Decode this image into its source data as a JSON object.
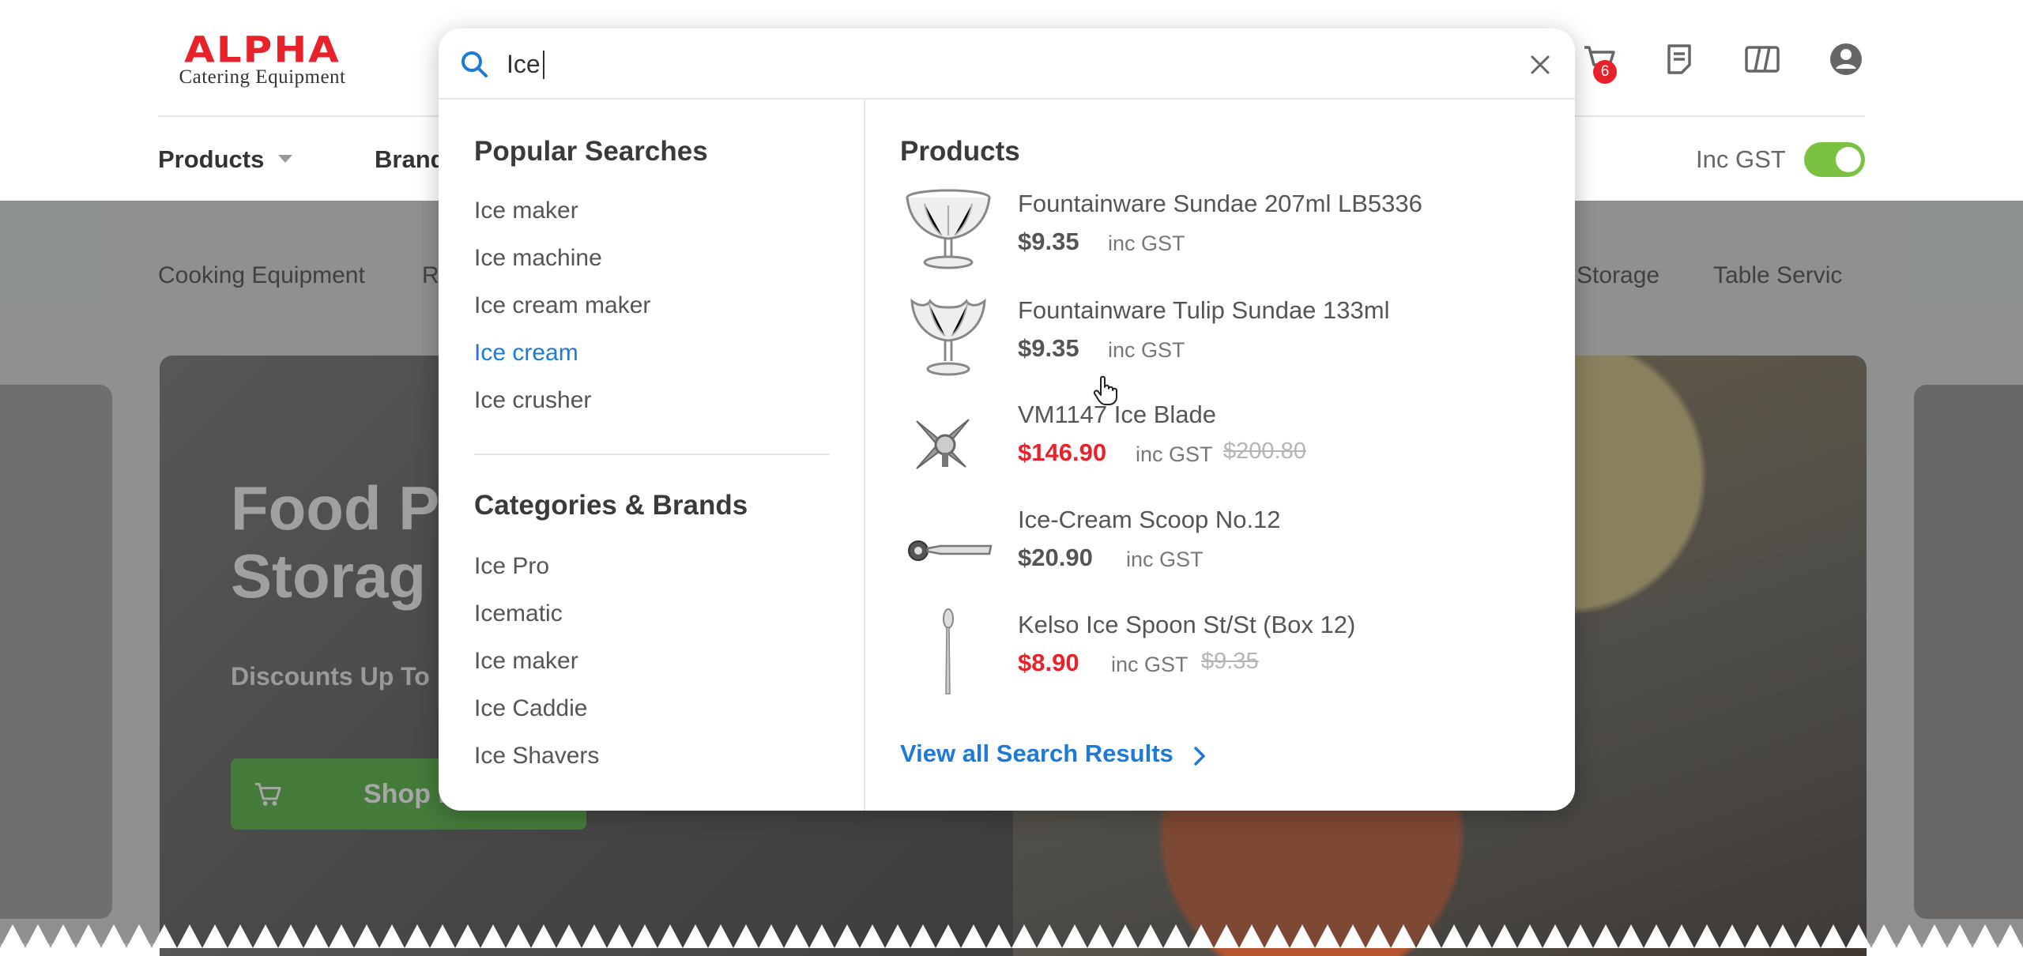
{
  "header": {
    "logo": {
      "word": "ALPHA",
      "sub": "Catering Equipment"
    },
    "icons": [
      "cart-icon",
      "quote-icon",
      "compare-icon",
      "account-icon"
    ],
    "cart_count": "6",
    "nav": {
      "products": "Products",
      "brands": "Brands"
    },
    "gst_label": "Inc GST",
    "gst_toggle_on": true
  },
  "category_bar": [
    "Cooking Equipment",
    "R",
    "Storage",
    "Table Servic"
  ],
  "hero": {
    "title_line1": "Food P",
    "title_line2": "Storag",
    "subtitle": "Discounts Up To",
    "button_label": "Shop N"
  },
  "search": {
    "query": "Ice",
    "popular_heading": "Popular Searches",
    "popular": [
      "Ice maker",
      "Ice machine",
      "Ice cream maker",
      "Ice cream",
      "Ice crusher"
    ],
    "active_popular": "Ice cream",
    "categories_heading": "Categories & Brands",
    "categories": [
      "Ice Pro",
      "Icematic",
      "Ice maker",
      "Ice Caddie",
      "Ice Shavers"
    ],
    "products_heading": "Products",
    "products": [
      {
        "name": "Fountainware Sundae 207ml LB5336",
        "price": "$9.35",
        "gst": "inc GST",
        "was": "",
        "image": "sundae-glass",
        "sale": false
      },
      {
        "name": "Fountainware Tulip Sundae 133ml",
        "price": "$9.35",
        "gst": "inc GST",
        "was": "",
        "image": "tulip-sundae-glass",
        "sale": false
      },
      {
        "name": "VM1147 Ice Blade",
        "price": "$146.90",
        "gst": "inc GST",
        "was": "$200.80",
        "image": "ice-blade",
        "sale": true
      },
      {
        "name": "Ice-Cream Scoop No.12",
        "price": "$20.90",
        "gst": "inc GST",
        "was": "",
        "image": "ice-cream-scoop",
        "sale": false
      },
      {
        "name": "Kelso Ice Spoon St/St (Box 12)",
        "price": "$8.90",
        "gst": "inc GST",
        "was": "$9.35",
        "image": "ice-spoon",
        "sale": true
      }
    ],
    "view_all": "View all Search Results"
  },
  "colors": {
    "brand_red": "#e8222b",
    "accent_blue": "#1e7ad6",
    "toggle_green": "#7cc242",
    "shop_green": "#4caf3b"
  }
}
